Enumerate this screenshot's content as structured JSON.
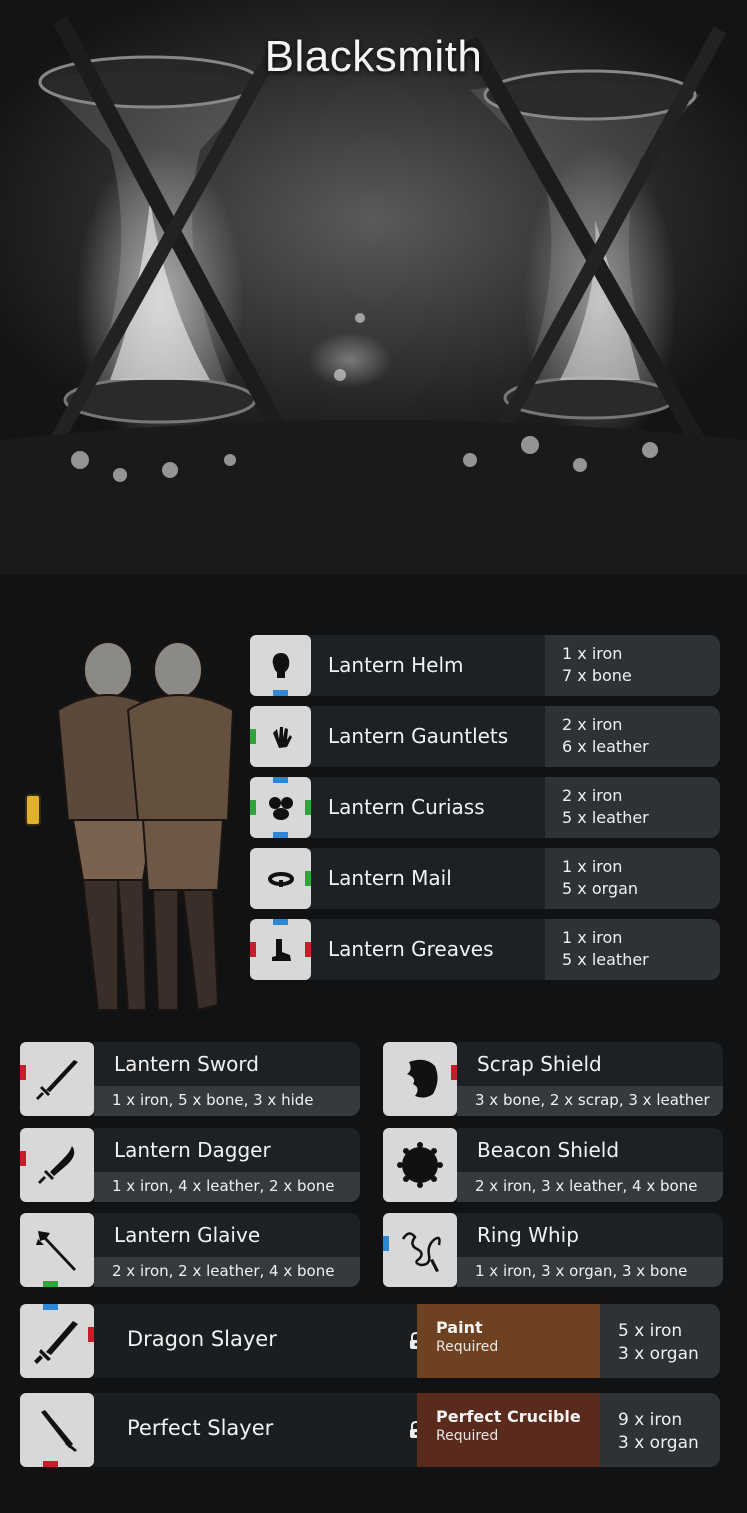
{
  "page_title": "Blacksmith",
  "armor": [
    {
      "name": "Lantern Helm",
      "cost": [
        "1 x iron",
        "7 x bone"
      ],
      "icon": "head-icon"
    },
    {
      "name": "Lantern Gauntlets",
      "cost": [
        "2 x iron",
        "6 x leather"
      ],
      "icon": "hand-icon"
    },
    {
      "name": "Lantern Curiass",
      "cost": [
        "2 x iron",
        "5 x leather"
      ],
      "icon": "torso-icon"
    },
    {
      "name": "Lantern Mail",
      "cost": [
        "1 x iron",
        "5 x organ"
      ],
      "icon": "waist-icon"
    },
    {
      "name": "Lantern Greaves",
      "cost": [
        "1 x iron",
        "5 x leather"
      ],
      "icon": "boot-icon"
    }
  ],
  "weapons": [
    {
      "name": "Lantern Sword",
      "cost": "1 x iron, 5 x bone, 3 x hide",
      "icon": "sword-icon"
    },
    {
      "name": "Scrap Shield",
      "cost": "3 x bone, 2 x scrap, 3 x leather",
      "icon": "scrap-shield-icon"
    },
    {
      "name": "Lantern Dagger",
      "cost": "1 x iron, 4 x leather, 2 x bone",
      "icon": "dagger-icon"
    },
    {
      "name": "Beacon Shield",
      "cost": "2 x iron, 3 x leather, 4 x bone",
      "icon": "round-shield-icon"
    },
    {
      "name": "Lantern Glaive",
      "cost": "2 x iron, 2 x leather, 4 x bone",
      "icon": "glaive-icon"
    },
    {
      "name": "Ring Whip",
      "cost": "1 x iron, 3 x organ, 3 x bone",
      "icon": "whip-icon"
    }
  ],
  "slayers": [
    {
      "name": "Dragon Slayer",
      "requirement": "Paint",
      "requirement_sub": "Required",
      "req_color": "#6e4220",
      "cost": [
        "5 x iron",
        "3 x organ"
      ],
      "icon": "greatsword-icon"
    },
    {
      "name": "Perfect Slayer",
      "requirement": "Perfect Crucible",
      "requirement_sub": "Required",
      "req_color": "#5a2a1c",
      "cost": [
        "9 x iron",
        "3 x organ"
      ],
      "icon": "greatsword-icon"
    }
  ],
  "colors": {
    "red": "#c81d2a",
    "blue": "#2d86d6",
    "green": "#2fa63a"
  }
}
